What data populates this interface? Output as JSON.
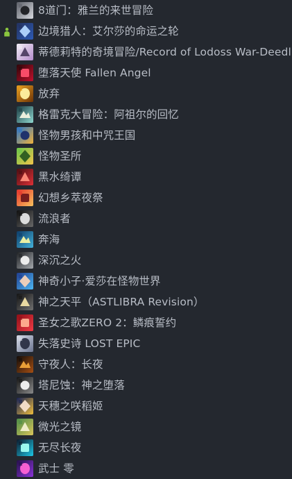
{
  "colors": {
    "background": "#24282f",
    "text": "#b8bdc6",
    "friend_status": "#8bc53f"
  },
  "games": [
    {
      "title": "8道门：雅兰的来世冒险",
      "icon": "eight-doors-icon",
      "c1": "#5c5f67",
      "c2": "#d7d9df",
      "c3": "#1c1d22",
      "status": ""
    },
    {
      "title": "边境猎人：艾尔莎的命运之轮",
      "icon": "frontier-hunter-icon",
      "c1": "#23315e",
      "c2": "#2d5ab4",
      "c3": "#b3d7ff",
      "status": "friend-online-icon"
    },
    {
      "title": "蒂德莉特的奇境冒险/Record of Lodoss War-Deedlit",
      "icon": "deedlit-icon",
      "c1": "#f2eef6",
      "c2": "#b38ccb",
      "c3": "#4e3e63",
      "status": ""
    },
    {
      "title": "堕落天使 Fallen Angel",
      "icon": "fallen-angel-icon",
      "c1": "#2d0609",
      "c2": "#c1102c",
      "c3": "#ff506d",
      "status": ""
    },
    {
      "title": "放弃",
      "icon": "abandon-icon",
      "c1": "#eaa120",
      "c2": "#6d3306",
      "c3": "#fff1a2",
      "status": ""
    },
    {
      "title": "格雷克大冒险：阿祖尔的回忆",
      "icon": "greak-icon",
      "c1": "#1a3b41",
      "c2": "#8fd8d0",
      "c3": "#f2f3e2",
      "status": ""
    },
    {
      "title": "怪物男孩和中咒王国",
      "icon": "monster-boy-icon",
      "c1": "#2a74c8",
      "c2": "#f0b23c",
      "c3": "#1a2d6a",
      "status": ""
    },
    {
      "title": "怪物圣所",
      "icon": "monster-sanctuary-icon",
      "c1": "#69c64a",
      "c2": "#f2c34b",
      "c3": "#2a5c20",
      "status": ""
    },
    {
      "title": "黑水绮谭",
      "icon": "blackwater-tale-icon",
      "c1": "#4a0e12",
      "c2": "#dd3036",
      "c3": "#ff8d7a",
      "status": ""
    },
    {
      "title": "幻想乡萃夜祭",
      "icon": "gensokyo-night-festival-icon",
      "c1": "#e3332c",
      "c2": "#f8c15d",
      "c3": "#70181b",
      "status": ""
    },
    {
      "title": "流浪者",
      "icon": "wanderer-icon",
      "c1": "#101010",
      "c2": "#686868",
      "c3": "#e5e5e5",
      "status": ""
    },
    {
      "title": "奔海",
      "icon": "benhai-icon",
      "c1": "#0d3c68",
      "c2": "#43b1d9",
      "c3": "#f3f4a2",
      "status": ""
    },
    {
      "title": "深沉之火",
      "icon": "deep-fire-icon",
      "c1": "#1f2124",
      "c2": "#a4a8ad",
      "c3": "#f3f3f3",
      "status": ""
    },
    {
      "title": "神奇小子·爱莎在怪物世界",
      "icon": "wonder-boy-asha-icon",
      "c1": "#203e90",
      "c2": "#4cb6f2",
      "c3": "#f4d3b9",
      "status": ""
    },
    {
      "title": "神之天平（ASTLIBRA Revision）",
      "icon": "astlibra-icon",
      "c1": "#141414",
      "c2": "#707070",
      "c3": "#f2e2a6",
      "status": ""
    },
    {
      "title": "圣女之歌ZERO 2：鳞痕誓约",
      "icon": "saintess-song-icon",
      "c1": "#8f0f17",
      "c2": "#ef3b45",
      "c3": "#ffb092",
      "status": ""
    },
    {
      "title": "失落史诗 LOST EPIC",
      "icon": "lost-epic-icon",
      "c1": "#d8dde9",
      "c2": "#6c7590",
      "c3": "#2b2f43",
      "status": ""
    },
    {
      "title": "守夜人：长夜",
      "icon": "vigil-icon",
      "c1": "#120c09",
      "c2": "#a54f13",
      "c3": "#f0a43a",
      "status": ""
    },
    {
      "title": "塔尼蚀：神之堕落",
      "icon": "tunic-eclipse-icon",
      "c1": "#151515",
      "c2": "#8a8a8a",
      "c3": "#f5f5f5",
      "status": ""
    },
    {
      "title": "天穗之咲稻姬",
      "icon": "sakuna-icon",
      "c1": "#172255",
      "c2": "#f0be3d",
      "c3": "#f7e2cd",
      "status": ""
    },
    {
      "title": "微光之镜",
      "icon": "glimmer-mirror-icon",
      "c1": "#4c8d47",
      "c2": "#d9c45b",
      "c3": "#f3f0ce",
      "status": ""
    },
    {
      "title": "无尽长夜",
      "icon": "endless-night-icon",
      "c1": "#0d1a2d",
      "c2": "#1cc7e5",
      "c3": "#a0fff4",
      "status": ""
    },
    {
      "title": "武士 零",
      "icon": "katana-zero-icon",
      "c1": "#25104a",
      "c2": "#8a33d8",
      "c3": "#ff63d5",
      "status": ""
    }
  ]
}
